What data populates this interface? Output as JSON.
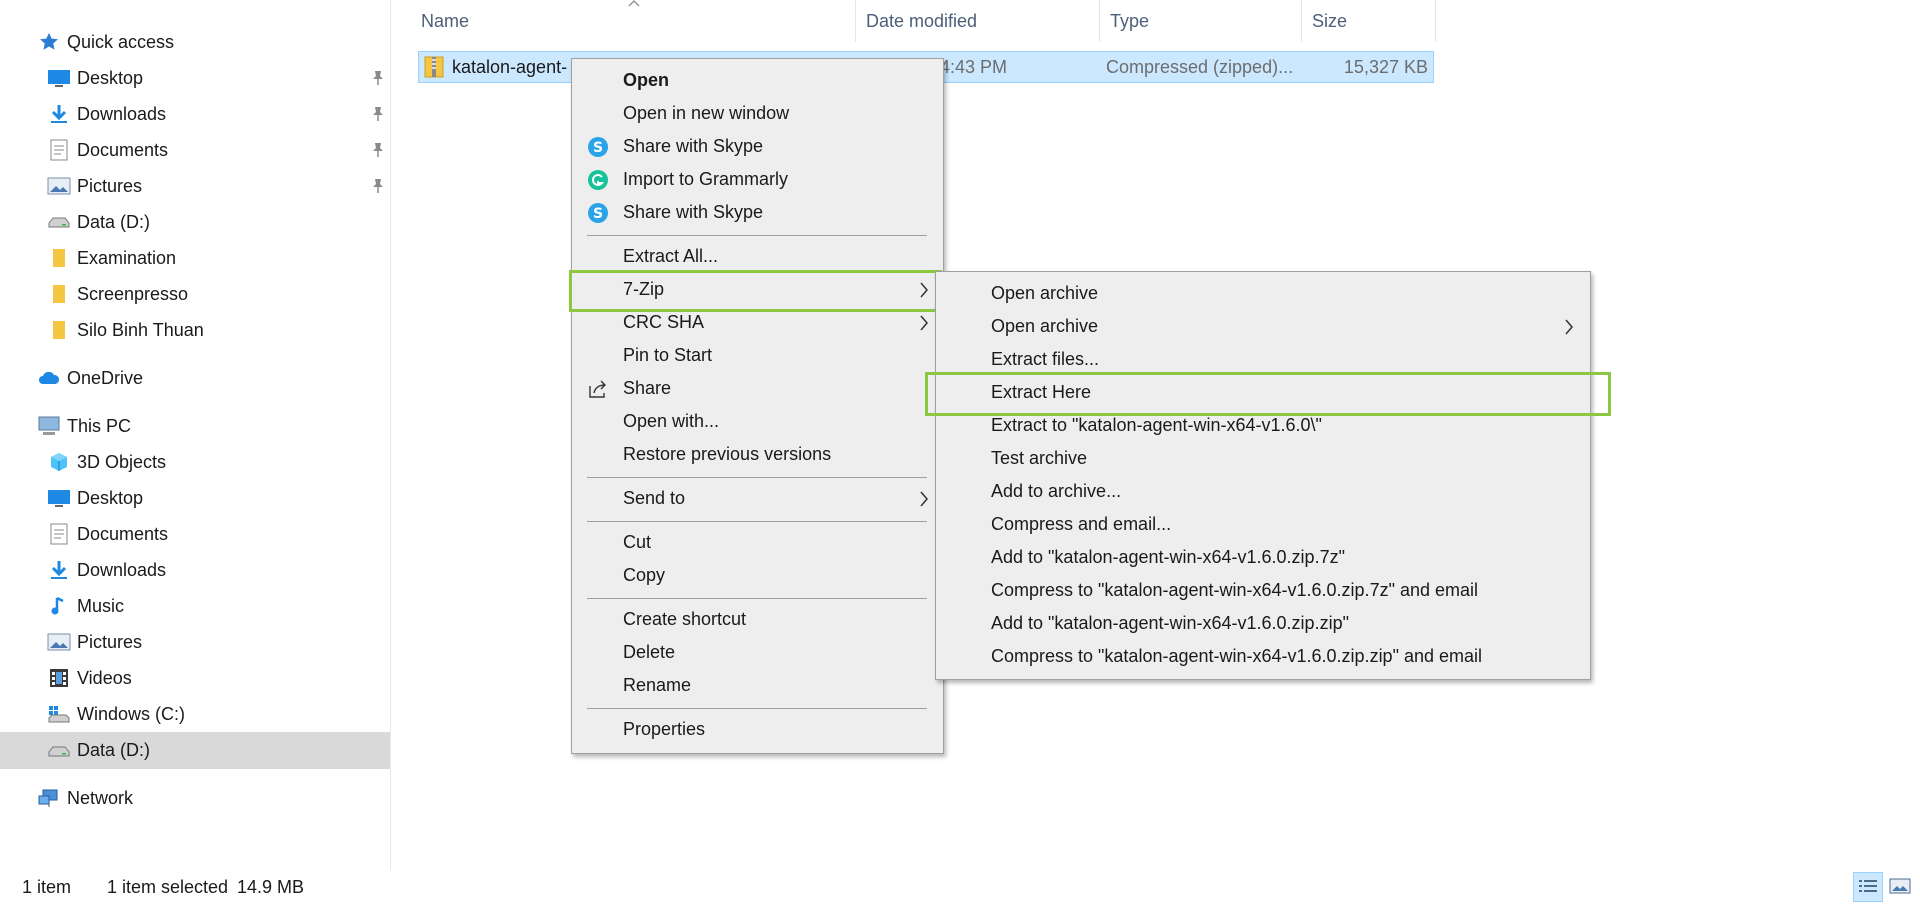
{
  "sidebar": {
    "quick_access": "Quick access",
    "items_quick": [
      {
        "label": "Desktop",
        "icon": "desktop-icon",
        "pinned": true
      },
      {
        "label": "Downloads",
        "icon": "downloads-icon",
        "pinned": true
      },
      {
        "label": "Documents",
        "icon": "documents-icon",
        "pinned": true
      },
      {
        "label": "Pictures",
        "icon": "pictures-icon",
        "pinned": true
      },
      {
        "label": "Data (D:)",
        "icon": "drive-icon",
        "pinned": false
      },
      {
        "label": "Examination",
        "icon": "folder-icon",
        "pinned": false
      },
      {
        "label": "Screenpresso",
        "icon": "folder-icon",
        "pinned": false
      },
      {
        "label": "Silo Binh Thuan",
        "icon": "folder-icon",
        "pinned": false
      }
    ],
    "onedrive": "OneDrive",
    "this_pc": "This PC",
    "items_pc": [
      {
        "label": "3D Objects",
        "icon": "3d-objects-icon"
      },
      {
        "label": "Desktop",
        "icon": "desktop-icon"
      },
      {
        "label": "Documents",
        "icon": "documents-icon"
      },
      {
        "label": "Downloads",
        "icon": "downloads-icon"
      },
      {
        "label": "Music",
        "icon": "music-icon"
      },
      {
        "label": "Pictures",
        "icon": "pictures-icon"
      },
      {
        "label": "Videos",
        "icon": "videos-icon"
      },
      {
        "label": "Windows (C:)",
        "icon": "windows-drive-icon"
      },
      {
        "label": "Data (D:)",
        "icon": "drive-icon",
        "selected": true
      }
    ],
    "network": "Network"
  },
  "columns": {
    "name": "Name",
    "date_modified": "Date modified",
    "type": "Type",
    "size": "Size"
  },
  "file": {
    "name": "katalon-agent-",
    "date": "4:43 PM",
    "type": "Compressed (zipped)...",
    "size": "15,327 KB"
  },
  "context_menu": {
    "open": "Open",
    "open_new_window": "Open in new window",
    "share_skype_1": "Share with Skype",
    "import_grammarly": "Import to Grammarly",
    "share_skype_2": "Share with Skype",
    "extract_all": "Extract All...",
    "seven_zip": "7-Zip",
    "crc_sha": "CRC SHA",
    "pin_to_start": "Pin to Start",
    "share": "Share",
    "open_with": "Open with...",
    "restore_versions": "Restore previous versions",
    "send_to": "Send to",
    "cut": "Cut",
    "copy": "Copy",
    "create_shortcut": "Create shortcut",
    "delete": "Delete",
    "rename": "Rename",
    "properties": "Properties"
  },
  "submenu_7zip": {
    "open_archive_1": "Open archive",
    "open_archive_2": "Open archive",
    "extract_files": "Extract files...",
    "extract_here": "Extract Here",
    "extract_to": "Extract to \"katalon-agent-win-x64-v1.6.0\\\"",
    "test_archive": "Test archive",
    "add_to_archive": "Add to archive...",
    "compress_email": "Compress and email...",
    "add_7z": "Add to \"katalon-agent-win-x64-v1.6.0.zip.7z\"",
    "compress_7z_email": "Compress to \"katalon-agent-win-x64-v1.6.0.zip.7z\" and email",
    "add_zip": "Add to \"katalon-agent-win-x64-v1.6.0.zip.zip\"",
    "compress_zip_email": "Compress to \"katalon-agent-win-x64-v1.6.0.zip.zip\" and email"
  },
  "status_bar": {
    "count": "1 item",
    "selection": "1 item selected",
    "size": "14.9 MB"
  },
  "colors": {
    "highlight": "#8dc63f",
    "selected_row": "#cce8ff",
    "menu_bg": "#eeeeee"
  }
}
